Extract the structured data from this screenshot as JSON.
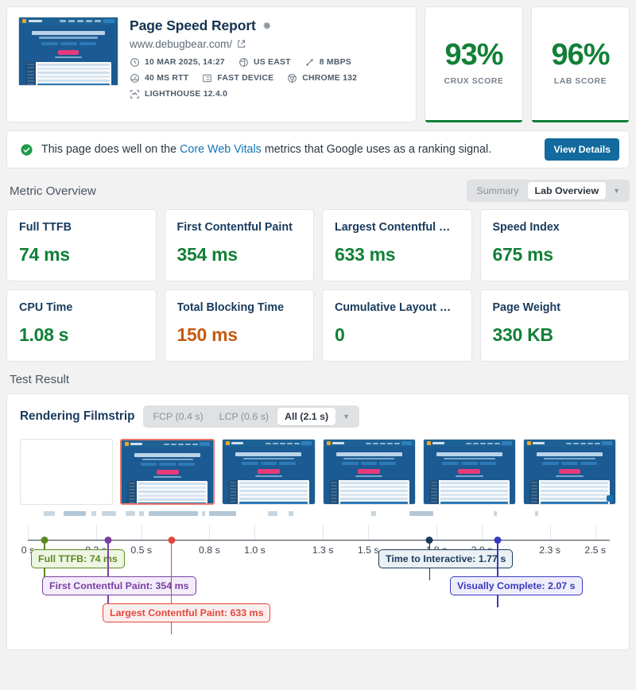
{
  "report": {
    "title": "Page Speed Report",
    "url": "www.debugbear.com/",
    "meta": [
      {
        "icon": "clock-icon",
        "label": "10 MAR 2025, 14:27"
      },
      {
        "icon": "globe-icon",
        "label": "US EAST"
      },
      {
        "icon": "bandwidth-icon",
        "label": "8 MBPS"
      },
      {
        "icon": "gauge-icon",
        "label": "40 MS RTT"
      },
      {
        "icon": "device-icon",
        "label": "FAST DEVICE"
      },
      {
        "icon": "chrome-icon",
        "label": "CHROME 132"
      },
      {
        "icon": "lighthouse-icon",
        "label": "LIGHTHOUSE 12.4.0"
      }
    ]
  },
  "scores": [
    {
      "value": "93%",
      "label": "CRUX SCORE",
      "color": "#128037"
    },
    {
      "value": "96%",
      "label": "LAB SCORE",
      "color": "#128037"
    }
  ],
  "banner": {
    "text_before": "This page does well on the ",
    "link": "Core Web Vitals",
    "text_after": " metrics that Google uses as a ranking signal.",
    "button": "View Details"
  },
  "metric_overview": {
    "heading": "Metric Overview",
    "segmented": {
      "left": "Summary",
      "active": "Lab Overview",
      "caret": "▼"
    },
    "cards": [
      {
        "title": "Full TTFB",
        "value": "74 ms",
        "status": "good"
      },
      {
        "title": "First Contentful Paint",
        "value": "354 ms",
        "status": "good"
      },
      {
        "title": "Largest Contentful …",
        "value": "633 ms",
        "status": "good"
      },
      {
        "title": "Speed Index",
        "value": "675 ms",
        "status": "good"
      },
      {
        "title": "CPU Time",
        "value": "1.08 s",
        "status": "good"
      },
      {
        "title": "Total Blocking Time",
        "value": "150 ms",
        "status": "warn"
      },
      {
        "title": "Cumulative Layout …",
        "value": "0",
        "status": "good"
      },
      {
        "title": "Page Weight",
        "value": "330 KB",
        "status": "good"
      }
    ]
  },
  "test_result": {
    "heading": "Test Result",
    "filmstrip_title": "Rendering Filmstrip",
    "filter": {
      "fcp": "FCP (0.4 s)",
      "lcp": "LCP (0.6 s)",
      "active": "All (2.1 s)",
      "caret": "▼"
    }
  },
  "chart_data": {
    "type": "timeline",
    "title": "Rendering Filmstrip",
    "xlabel": "",
    "xlim": [
      0,
      2.62
    ],
    "tick_labels": [
      "0 s",
      "0.3 s",
      "0.5 s",
      "0.8 s",
      "1.0 s",
      "1.3 s",
      "1.5 s",
      "1.8 s",
      "2.0 s",
      "2.3 s",
      "2.5 s"
    ],
    "tick_values": [
      0,
      0.3,
      0.5,
      0.8,
      1.0,
      1.3,
      1.5,
      1.8,
      2.0,
      2.3,
      2.5
    ],
    "frames": [
      {
        "index": 0,
        "state": "blank",
        "highlight": "none"
      },
      {
        "index": 1,
        "state": "rendered",
        "highlight": "lcp"
      },
      {
        "index": 2,
        "state": "rendered",
        "highlight": "none"
      },
      {
        "index": 3,
        "state": "rendered",
        "highlight": "none"
      },
      {
        "index": 4,
        "state": "rendered",
        "highlight": "none"
      },
      {
        "index": 5,
        "state": "rendered",
        "highlight": "none"
      }
    ],
    "markers": [
      {
        "name": "Full TTFB",
        "label": "Full TTFB: 74 ms",
        "value": 0.074,
        "color": "#5c8a1f",
        "bg": "#eef5e3",
        "row": 0
      },
      {
        "name": "First Contentful Paint",
        "label": "First Contentful Paint: 354 ms",
        "value": 0.354,
        "color": "#7b3fa3",
        "bg": "#f3ecfa",
        "row": 1
      },
      {
        "name": "Largest Contentful Paint",
        "label": "Largest Contentful Paint: 633 ms",
        "value": 0.633,
        "color": "#e0483f",
        "bg": "#fdeeed",
        "row": 2
      },
      {
        "name": "Time to Interactive",
        "label": "Time to Interactive: 1.77 s",
        "value": 1.77,
        "color": "#1b3a5c",
        "bg": "#eaf0f4",
        "row": 0
      },
      {
        "name": "Visually Complete",
        "label": "Visually Complete: 2.07 s",
        "value": 2.07,
        "color": "#3a3ac0",
        "bg": "#eeeefb",
        "row": 1
      }
    ]
  }
}
